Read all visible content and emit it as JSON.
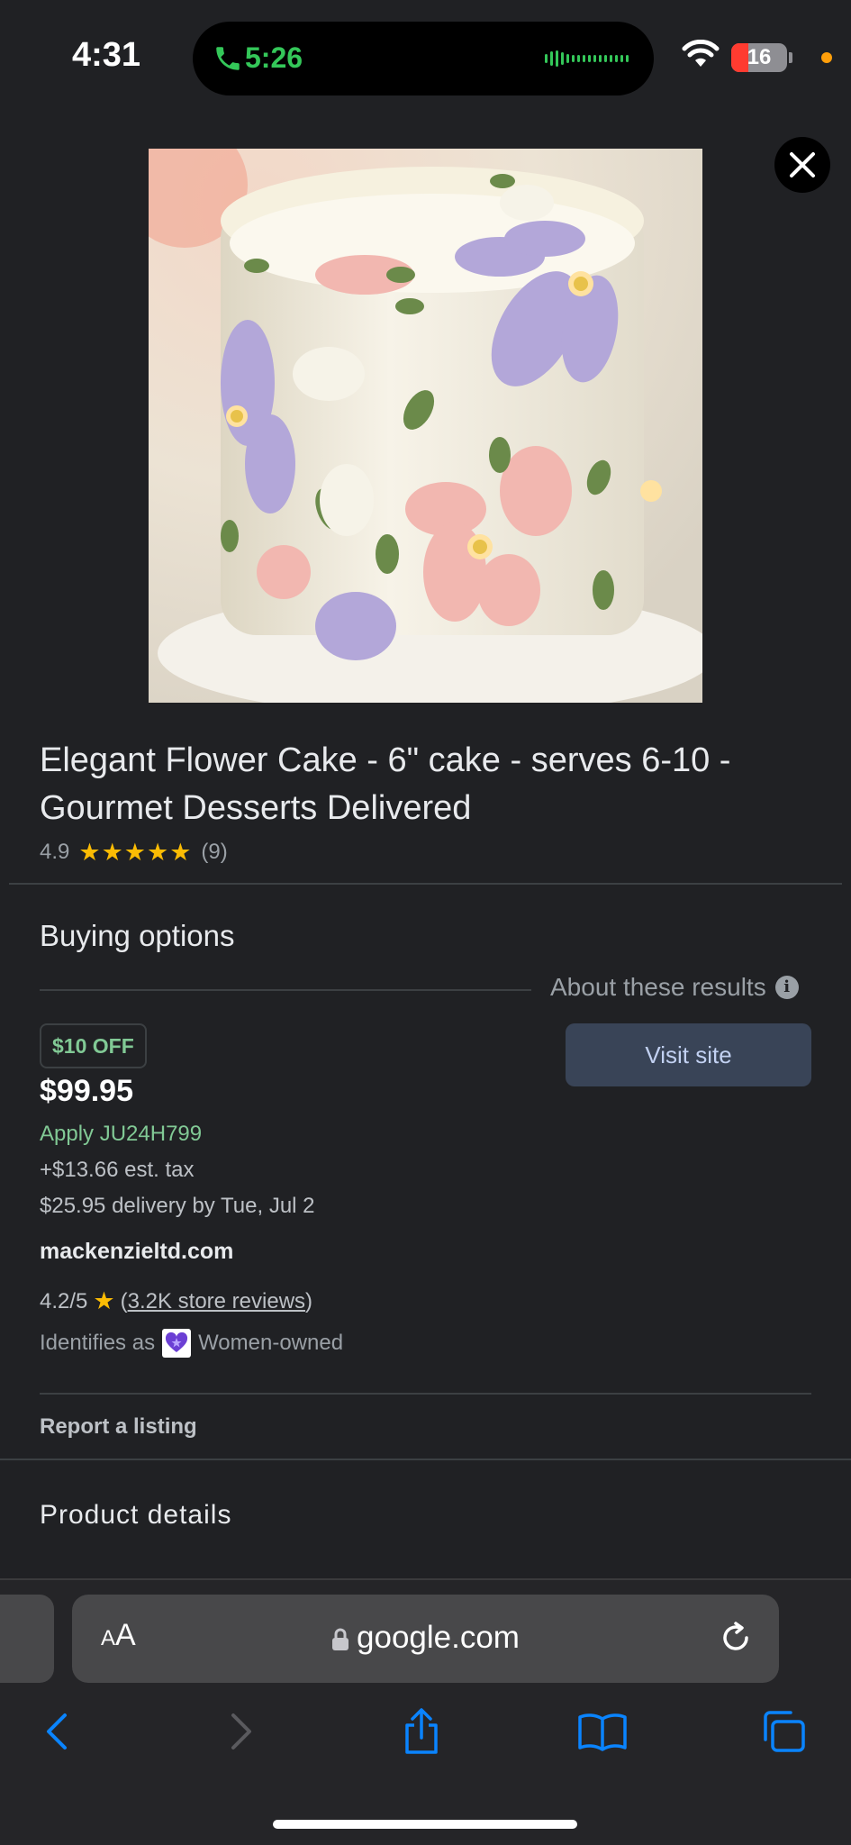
{
  "status_bar": {
    "time": "4:31",
    "call_duration": "5:26",
    "battery_level": "16"
  },
  "product": {
    "title": "Elegant Flower Cake - 6\" cake - serves 6-10 - Gourmet Desserts Delivered",
    "rating": "4.9",
    "stars": "★★★★★",
    "review_count": "(9)",
    "image_alt": "cake-photo"
  },
  "buying_options": {
    "heading": "Buying options",
    "about_results": "About these results",
    "discount_badge": "$10 OFF",
    "visit_site_label": "Visit site",
    "price": "$99.95",
    "promo_code": "Apply JU24H799",
    "tax": "+$13.66 est. tax",
    "delivery": "$25.95 delivery by Tue, Jul 2",
    "store_name": "mackenzieltd.com",
    "store_rating": "4.2/5",
    "store_reviews_open": "(",
    "store_reviews_link": "3.2K store reviews",
    "store_reviews_close": ")",
    "identifies_as": "Identifies as",
    "ownership": "Women-owned",
    "report_link": "Report a listing"
  },
  "product_details": {
    "heading": "Product details"
  },
  "browser": {
    "aa_label_small": "A",
    "aa_label_large": "A",
    "url": "google.com"
  },
  "colors": {
    "background": "#202124",
    "accent_green": "#81c995",
    "star_yellow": "#fbbc04",
    "button_bg": "#394457",
    "safari_blue": "#0a84ff"
  }
}
